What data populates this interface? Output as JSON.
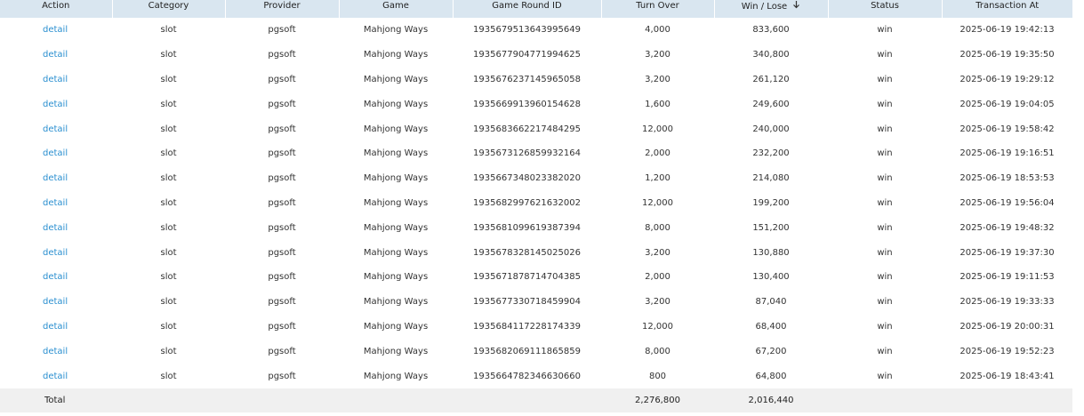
{
  "columns": [
    {
      "key": "action",
      "label": "Action"
    },
    {
      "key": "category",
      "label": "Category"
    },
    {
      "key": "provider",
      "label": "Provider"
    },
    {
      "key": "game",
      "label": "Game"
    },
    {
      "key": "round_id",
      "label": "Game Round ID"
    },
    {
      "key": "turnover",
      "label": "Turn Over"
    },
    {
      "key": "winlose",
      "label": "Win / Lose",
      "sorted": "desc",
      "sort_icon": "arrow-down-icon"
    },
    {
      "key": "status",
      "label": "Status"
    },
    {
      "key": "txn_at",
      "label": "Transaction At"
    }
  ],
  "rows": [
    {
      "action": "detail",
      "category": "slot",
      "provider": "pgsoft",
      "game": "Mahjong Ways",
      "round_id": "1935679513643995649",
      "turnover": "4,000",
      "winlose": "833,600",
      "status": "win",
      "txn_at": "2025-06-19 19:42:13"
    },
    {
      "action": "detail",
      "category": "slot",
      "provider": "pgsoft",
      "game": "Mahjong Ways",
      "round_id": "1935677904771994625",
      "turnover": "3,200",
      "winlose": "340,800",
      "status": "win",
      "txn_at": "2025-06-19 19:35:50"
    },
    {
      "action": "detail",
      "category": "slot",
      "provider": "pgsoft",
      "game": "Mahjong Ways",
      "round_id": "1935676237145965058",
      "turnover": "3,200",
      "winlose": "261,120",
      "status": "win",
      "txn_at": "2025-06-19 19:29:12"
    },
    {
      "action": "detail",
      "category": "slot",
      "provider": "pgsoft",
      "game": "Mahjong Ways",
      "round_id": "1935669913960154628",
      "turnover": "1,600",
      "winlose": "249,600",
      "status": "win",
      "txn_at": "2025-06-19 19:04:05"
    },
    {
      "action": "detail",
      "category": "slot",
      "provider": "pgsoft",
      "game": "Mahjong Ways",
      "round_id": "1935683662217484295",
      "turnover": "12,000",
      "winlose": "240,000",
      "status": "win",
      "txn_at": "2025-06-19 19:58:42"
    },
    {
      "action": "detail",
      "category": "slot",
      "provider": "pgsoft",
      "game": "Mahjong Ways",
      "round_id": "1935673126859932164",
      "turnover": "2,000",
      "winlose": "232,200",
      "status": "win",
      "txn_at": "2025-06-19 19:16:51"
    },
    {
      "action": "detail",
      "category": "slot",
      "provider": "pgsoft",
      "game": "Mahjong Ways",
      "round_id": "1935667348023382020",
      "turnover": "1,200",
      "winlose": "214,080",
      "status": "win",
      "txn_at": "2025-06-19 18:53:53"
    },
    {
      "action": "detail",
      "category": "slot",
      "provider": "pgsoft",
      "game": "Mahjong Ways",
      "round_id": "1935682997621632002",
      "turnover": "12,000",
      "winlose": "199,200",
      "status": "win",
      "txn_at": "2025-06-19 19:56:04"
    },
    {
      "action": "detail",
      "category": "slot",
      "provider": "pgsoft",
      "game": "Mahjong Ways",
      "round_id": "1935681099619387394",
      "turnover": "8,000",
      "winlose": "151,200",
      "status": "win",
      "txn_at": "2025-06-19 19:48:32"
    },
    {
      "action": "detail",
      "category": "slot",
      "provider": "pgsoft",
      "game": "Mahjong Ways",
      "round_id": "1935678328145025026",
      "turnover": "3,200",
      "winlose": "130,880",
      "status": "win",
      "txn_at": "2025-06-19 19:37:30"
    },
    {
      "action": "detail",
      "category": "slot",
      "provider": "pgsoft",
      "game": "Mahjong Ways",
      "round_id": "1935671878714704385",
      "turnover": "2,000",
      "winlose": "130,400",
      "status": "win",
      "txn_at": "2025-06-19 19:11:53"
    },
    {
      "action": "detail",
      "category": "slot",
      "provider": "pgsoft",
      "game": "Mahjong Ways",
      "round_id": "1935677330718459904",
      "turnover": "3,200",
      "winlose": "87,040",
      "status": "win",
      "txn_at": "2025-06-19 19:33:33"
    },
    {
      "action": "detail",
      "category": "slot",
      "provider": "pgsoft",
      "game": "Mahjong Ways",
      "round_id": "1935684117228174339",
      "turnover": "12,000",
      "winlose": "68,400",
      "status": "win",
      "txn_at": "2025-06-19 20:00:31"
    },
    {
      "action": "detail",
      "category": "slot",
      "provider": "pgsoft",
      "game": "Mahjong Ways",
      "round_id": "1935682069111865859",
      "turnover": "8,000",
      "winlose": "67,200",
      "status": "win",
      "txn_at": "2025-06-19 19:52:23"
    },
    {
      "action": "detail",
      "category": "slot",
      "provider": "pgsoft",
      "game": "Mahjong Ways",
      "round_id": "1935664782346630660",
      "turnover": "800",
      "winlose": "64,800",
      "status": "win",
      "txn_at": "2025-06-19 18:43:41"
    }
  ],
  "footer": {
    "label": "Total",
    "turnover": "2,276,800",
    "winlose": "2,016,440"
  },
  "colors": {
    "header_bg": "#d9e6f0",
    "link": "#2a8fd0",
    "footer_bg": "#f0f0f0"
  }
}
